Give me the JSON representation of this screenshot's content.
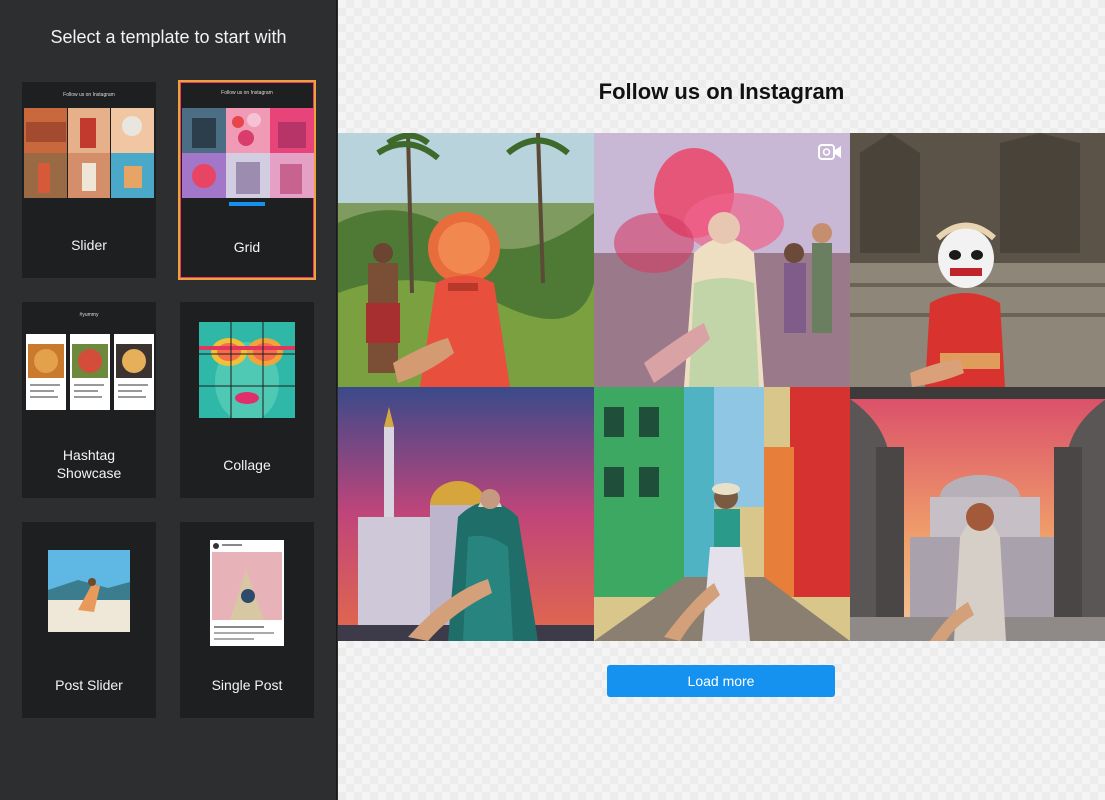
{
  "sidebar": {
    "title": "Select a template to start with",
    "templates": [
      {
        "label": "Slider",
        "thumb_title": "Follow us on Instagram"
      },
      {
        "label": "Grid",
        "thumb_title": "Follow us on Instagram",
        "selected": true
      },
      {
        "label": "Hashtag\nShowcase",
        "thumb_title": "#yummy"
      },
      {
        "label": "Collage"
      },
      {
        "label": "Post Slider"
      },
      {
        "label": "Single Post"
      }
    ]
  },
  "preview": {
    "title": "Follow us on Instagram",
    "load_more_label": "Load more",
    "photos": [
      {
        "name": "jungle-rice-terrace"
      },
      {
        "name": "holi-colors",
        "video": true
      },
      {
        "name": "temple-mask"
      },
      {
        "name": "mosque-sunset"
      },
      {
        "name": "colorful-street"
      },
      {
        "name": "mosque-arches"
      }
    ]
  },
  "colors": {
    "accent_blue": "#1592f0",
    "selected_border": "#f0a03c",
    "sidebar_bg": "#2d2e30",
    "card_bg": "#1e1f21"
  }
}
